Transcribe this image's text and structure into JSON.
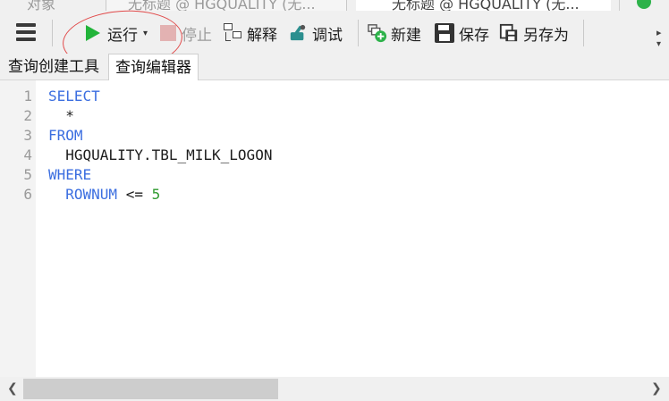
{
  "window_tabs": [
    {
      "label": "对象"
    },
    {
      "label": "无标题 @ HGQUALITY (无..."
    },
    {
      "label": "无标题 @ HGQUALITY (无..."
    }
  ],
  "toolbar": {
    "run_label": "运行",
    "stop_label": "停止",
    "explain_label": "解释",
    "debug_label": "调试",
    "new_label": "新建",
    "save_label": "保存",
    "save_as_label": "另存为"
  },
  "subtabs": [
    {
      "label": "查询创建工具",
      "active": false
    },
    {
      "label": "查询编辑器",
      "active": true
    }
  ],
  "editor": {
    "lines": [
      {
        "number": "1",
        "tokens": [
          {
            "text": "SELECT",
            "type": "keyword"
          }
        ]
      },
      {
        "number": "2",
        "tokens": [
          {
            "text": "  *",
            "type": "plain"
          }
        ]
      },
      {
        "number": "3",
        "tokens": [
          {
            "text": "FROM",
            "type": "keyword"
          }
        ]
      },
      {
        "number": "4",
        "tokens": [
          {
            "text": "  HGQUALITY.TBL_MILK_LOGON",
            "type": "plain"
          }
        ]
      },
      {
        "number": "5",
        "tokens": [
          {
            "text": "WHERE",
            "type": "keyword"
          }
        ]
      },
      {
        "number": "6",
        "tokens": [
          {
            "text": "  ROWNUM",
            "type": "keyword"
          },
          {
            "text": " <= ",
            "type": "plain"
          },
          {
            "text": "5",
            "type": "number"
          }
        ]
      }
    ]
  },
  "colors": {
    "keyword": "#3b6ee0",
    "number": "#2f9a2f",
    "run_icon": "#22b43a",
    "annotation_circle": "#e14a4a"
  },
  "icons": {
    "menu": "hamburger-icon",
    "run": "play-icon",
    "stop": "stop-icon",
    "explain": "explain-icon",
    "debug": "debug-icon",
    "new": "new-query-icon",
    "save": "save-icon",
    "save_as": "save-as-icon"
  },
  "horizontal_scroll": {
    "fraction_visible": 0.41
  }
}
